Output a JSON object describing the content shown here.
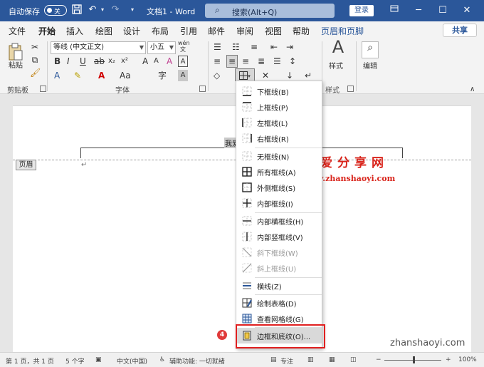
{
  "titlebar": {
    "autosave_label": "自动保存",
    "autosave_state": "关",
    "doc_title": "文档1 - Word",
    "search_placeholder": "搜索(Alt+Q)",
    "login_label": "登录",
    "save_icon": "save-icon",
    "undo_icon": "undo-icon",
    "redo_icon": "redo-icon"
  },
  "tabs": [
    "文件",
    "开始",
    "插入",
    "绘图",
    "设计",
    "布局",
    "引用",
    "邮件",
    "审阅",
    "视图",
    "帮助",
    "页眉和页脚"
  ],
  "active_tab": "开始",
  "share_label": "共享",
  "ribbon": {
    "paste_label": "粘贴",
    "clipboard_label": "剪贴板",
    "font_name": "等线 (中文正文)",
    "font_size": "小五",
    "wen_label": "wén",
    "font_group_label": "字体",
    "style_label": "样式",
    "styles_group_label": "样式",
    "edit_label": "编辑"
  },
  "document": {
    "selected_text": "我爱",
    "header_tag": "页眉"
  },
  "border_menu": {
    "items": [
      {
        "label": "下框线(B)",
        "enabled": true
      },
      {
        "label": "上框线(P)",
        "enabled": true
      },
      {
        "label": "左框线(L)",
        "enabled": true
      },
      {
        "label": "右框线(R)",
        "enabled": true
      },
      {
        "label": "无框线(N)",
        "enabled": true
      },
      {
        "label": "所有框线(A)",
        "enabled": true
      },
      {
        "label": "外侧框线(S)",
        "enabled": true
      },
      {
        "label": "内部框线(I)",
        "enabled": true
      },
      {
        "label": "内部横框线(H)",
        "enabled": true
      },
      {
        "label": "内部竖框线(V)",
        "enabled": true
      },
      {
        "label": "斜下框线(W)",
        "enabled": false
      },
      {
        "label": "斜上框线(U)",
        "enabled": false
      },
      {
        "label": "横线(Z)",
        "enabled": true
      },
      {
        "label": "绘制表格(D)",
        "enabled": true
      },
      {
        "label": "查看网格线(G)",
        "enabled": true
      },
      {
        "label": "边框和底纹(O)...",
        "enabled": true,
        "highlighted": true
      }
    ],
    "step_badge": "4"
  },
  "watermark": {
    "line1": "我爱分享网",
    "line2": "www.zhanshaoyi.com",
    "corner": "zhanshaoyi.com"
  },
  "statusbar": {
    "page": "第 1 页，共 1 页",
    "words": "5 个字",
    "language": "中文(中国)",
    "accessibility": "辅助功能: 一切就绪",
    "focus": "专注",
    "zoom": "100%"
  },
  "colors": {
    "title_blue": "#2b579a",
    "highlight_red": "#e02020",
    "watermark_red": "#d9251c"
  }
}
